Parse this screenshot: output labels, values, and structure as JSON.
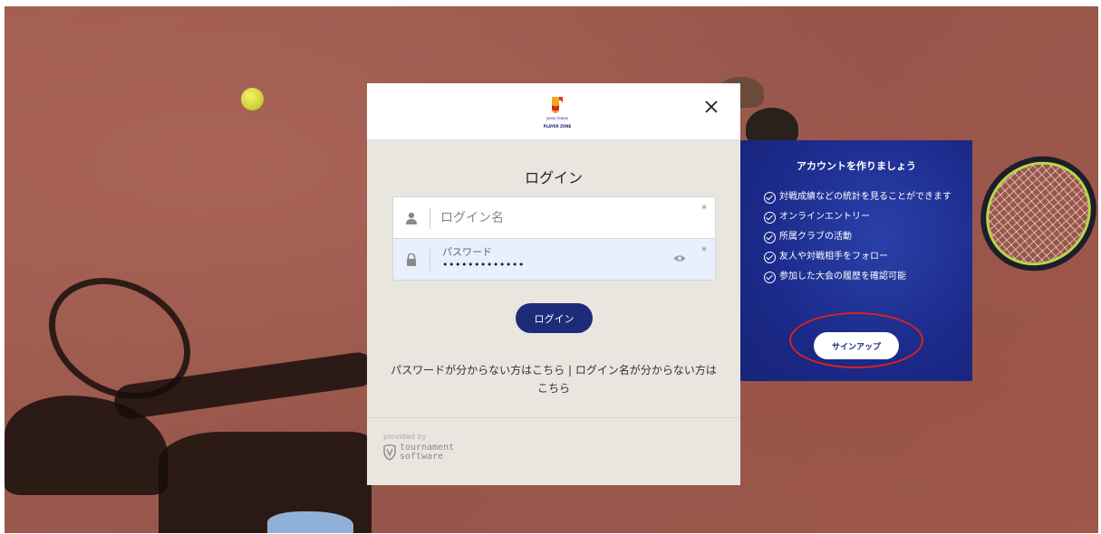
{
  "logo": {
    "name": "japan-tennis-logo",
    "caption": "PLAYER ZONE",
    "sub": "JAPAN TENNIS"
  },
  "modal": {
    "title": "ログイン",
    "username": {
      "placeholder": "ログイン名",
      "required_marker": "*"
    },
    "password": {
      "label": "パスワード",
      "value": "•••••••••••••",
      "required_marker": "*"
    },
    "login_button": "ログイン",
    "forgot_password": "パスワードが分からない方はこちら",
    "separator": "|",
    "forgot_username": "ログイン名が分からない方はこちら",
    "provided_by": "provided by",
    "provider_line1": "tournament",
    "provider_line2": "software"
  },
  "panel": {
    "title": "アカウントを作りましょう",
    "benefits": [
      "対戦成績などの統計を見ることができます",
      "オンラインエントリー",
      "所属クラブの活動",
      "友人や対戦相手をフォロー",
      "参加した大会の履歴を確認可能"
    ],
    "signup_button": "サインアップ"
  },
  "colors": {
    "brand_navy": "#1e2a7a",
    "highlight": "#d8231e"
  },
  "icons": [
    "user-icon",
    "lock-icon",
    "eye-icon",
    "close-icon",
    "check-circle-icon",
    "shield-icon"
  ]
}
